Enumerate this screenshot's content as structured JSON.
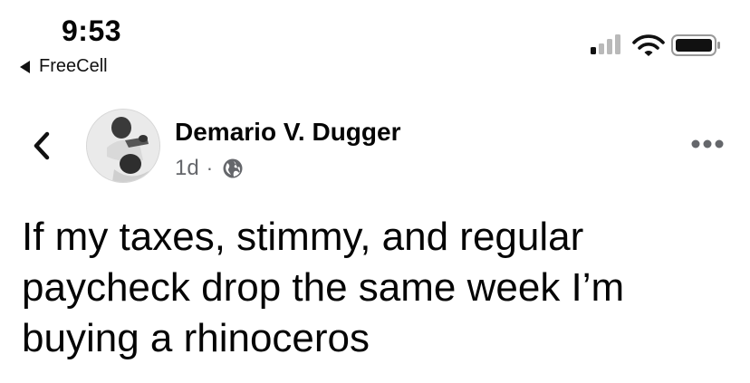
{
  "status_bar": {
    "time": "9:53",
    "back_app_label": "FreeCell",
    "signal_icon": "cellular-signal-icon",
    "wifi_icon": "wifi-icon",
    "battery_icon": "battery-icon"
  },
  "post": {
    "author_name": "Demario V. Dugger",
    "time_ago": "1d",
    "separator": "·",
    "audience_icon": "globe-icon",
    "body_text": "If my taxes, stimmy, and regular\npaycheck drop the same week I’m\nbuying a rhinoceros"
  },
  "colors": {
    "text_primary": "#050505",
    "text_secondary": "#65676b",
    "background": "#ffffff"
  }
}
